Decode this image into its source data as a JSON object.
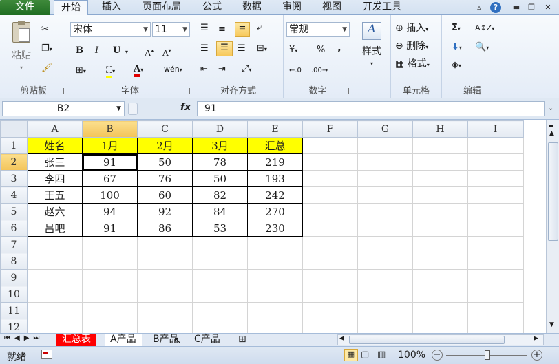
{
  "tabs": {
    "file": "文件",
    "home": "开始",
    "insert": "插入",
    "layout": "页面布局",
    "formulas": "公式",
    "data": "数据",
    "review": "审阅",
    "view": "视图",
    "developer": "开发工具"
  },
  "ribbon": {
    "clipboard": {
      "label": "剪贴板",
      "paste": "粘贴"
    },
    "font": {
      "label": "字体",
      "name": "宋体",
      "size": "11",
      "bold": "B",
      "italic": "I",
      "underline": "U"
    },
    "alignment": {
      "label": "对齐方式"
    },
    "number": {
      "label": "数字",
      "format": "常规",
      "percent": "%",
      "comma": ","
    },
    "styles": {
      "label": "样式"
    },
    "cells": {
      "label": "单元格",
      "insert": "插入",
      "delete": "删除",
      "format": "格式"
    },
    "editing": {
      "label": "编辑"
    }
  },
  "formula_bar": {
    "name_box": "B2",
    "fx": "fx",
    "value": "91"
  },
  "grid": {
    "columns": [
      "A",
      "B",
      "C",
      "D",
      "E",
      "F",
      "G",
      "H",
      "I"
    ],
    "rows": [
      "1",
      "2",
      "3",
      "4",
      "5",
      "6",
      "7",
      "8",
      "9",
      "10",
      "11",
      "12"
    ],
    "header": [
      "姓名",
      "1月",
      "2月",
      "3月",
      "汇总"
    ],
    "records": [
      [
        "张三",
        "91",
        "50",
        "78",
        "219"
      ],
      [
        "李四",
        "67",
        "76",
        "50",
        "193"
      ],
      [
        "王五",
        "100",
        "60",
        "82",
        "242"
      ],
      [
        "赵六",
        "94",
        "92",
        "84",
        "270"
      ],
      [
        "吕吧",
        "91",
        "86",
        "53",
        "230"
      ]
    ],
    "active_cell": "B2",
    "colors": {
      "header_fill": "#ffff00",
      "active_tab": "#ff0000"
    }
  },
  "sheets": [
    "汇总表",
    "A产品",
    "B产品",
    "C产品"
  ],
  "status": {
    "mode": "就绪",
    "zoom": "100%"
  }
}
